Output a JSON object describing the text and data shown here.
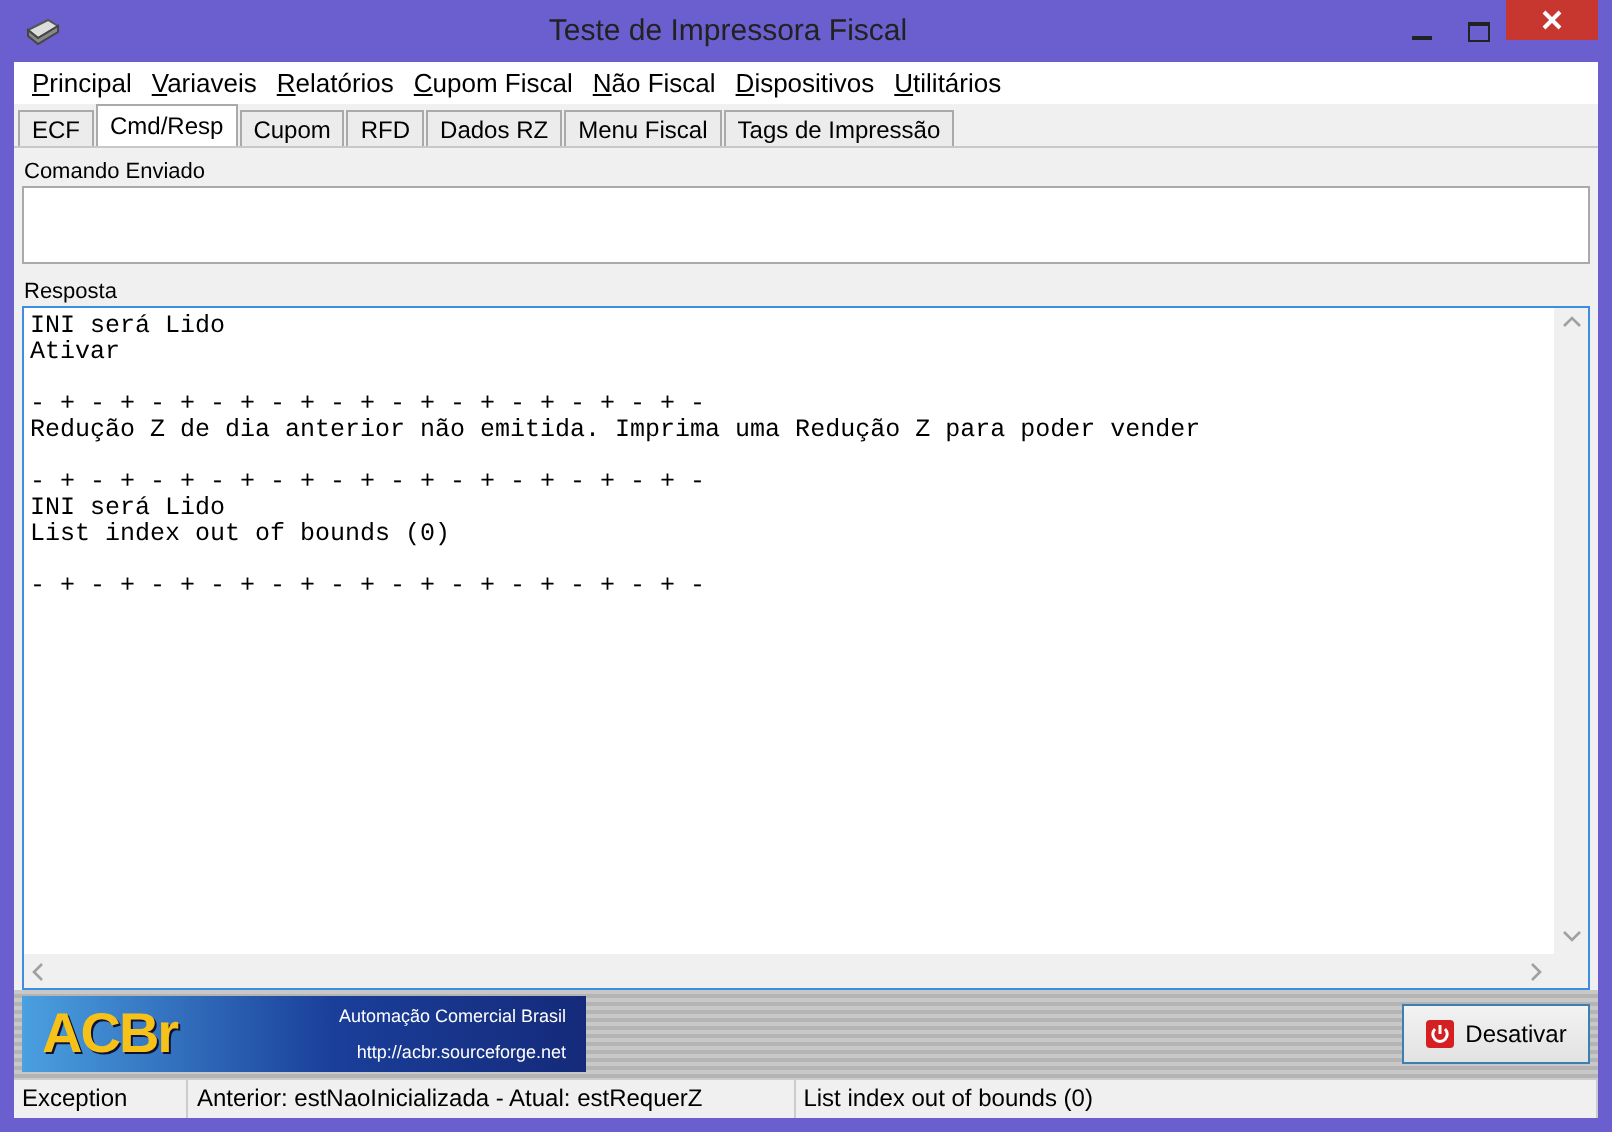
{
  "window": {
    "title": "Teste de Impressora Fiscal"
  },
  "menu": [
    {
      "label": "Principal"
    },
    {
      "label": "Variaveis"
    },
    {
      "label": "Relatórios"
    },
    {
      "label": "Cupom Fiscal"
    },
    {
      "label": "Não Fiscal"
    },
    {
      "label": "Dispositivos"
    },
    {
      "label": "Utilitários"
    }
  ],
  "tabs": [
    {
      "label": "ECF",
      "selected": false
    },
    {
      "label": "Cmd/Resp",
      "selected": true
    },
    {
      "label": "Cupom",
      "selected": false
    },
    {
      "label": "RFD",
      "selected": false
    },
    {
      "label": "Dados RZ",
      "selected": false
    },
    {
      "label": "Menu Fiscal",
      "selected": false
    },
    {
      "label": "Tags de Impressão",
      "selected": false
    }
  ],
  "command": {
    "label": "Comando Enviado"
  },
  "response": {
    "label": "Resposta",
    "value": "INI será Lido\nAtivar\n\n- + - + - + - + - + - + - + - + - + - + - + -\nRedução Z de dia anterior não emitida. Imprima uma Redução Z para poder vender\n\n- + - + - + - + - + - + - + - + - + - + - + -\nINI será Lido\nList index out of bounds (0)\n\n- + - + - + - + - + - + - + - + - + - + - + -"
  },
  "banner": {
    "logo": "ACBr",
    "tagline": "Automação Comercial Brasil",
    "url": "http://acbr.sourceforge.net"
  },
  "buttons": [
    {
      "label": "Desativar"
    }
  ],
  "status_bar": [
    "Exception",
    "Anterior: estNaoInicializada - Atual: estRequerZ",
    "List index out of bounds (0)"
  ]
}
